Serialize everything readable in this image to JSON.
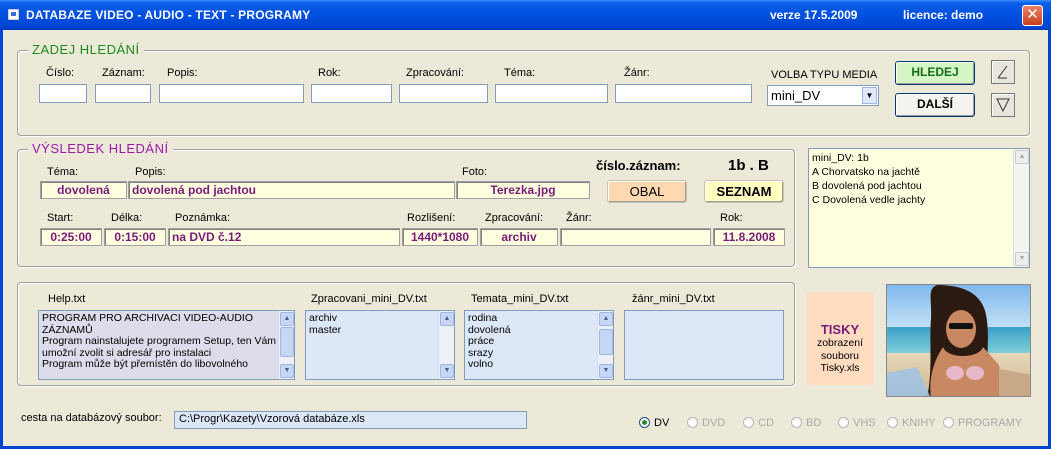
{
  "window": {
    "title": "DATABAZE  VIDEO - AUDIO - TEXT - PROGRAMY",
    "version": "verze 17.5.2009",
    "licence": "licence: demo",
    "close_glyph": "✕"
  },
  "search": {
    "legend": "ZADEJ  HLEDÁNÍ",
    "fields": [
      {
        "label": "Číslo:",
        "value": ""
      },
      {
        "label": "Záznam:",
        "value": ""
      },
      {
        "label": "Popis:",
        "value": ""
      },
      {
        "label": "Rok:",
        "value": ""
      },
      {
        "label": "Zpracování:",
        "value": ""
      },
      {
        "label": "Téma:",
        "value": ""
      },
      {
        "label": "Žánr:",
        "value": ""
      }
    ],
    "media_type_label": "VOLBA TYPU MEDIA",
    "media_type_value": "mini_DV",
    "search_button": "HLEDEJ",
    "next_button": "DALŠÍ"
  },
  "result": {
    "legend": "VÝSLEDEK  HLEDÁNÍ",
    "record_number_label": "číslo.záznam:",
    "record_number_value": "1b . B",
    "labels": {
      "tema": "Téma:",
      "popis": "Popis:",
      "foto": "Foto:",
      "start": "Start:",
      "delka": "Délka:",
      "poznamka": "Poznámka:",
      "rozliseni": "Rozlišení:",
      "zpracovani": "Zpracování:",
      "zanr": "Žánr:",
      "rok": "Rok:"
    },
    "values": {
      "tema": "dovolená",
      "popis": "dovolená pod jachtou",
      "foto": "Terezka.jpg",
      "start": "0:25:00",
      "delka": "0:15:00",
      "poznamka": "na DVD č.12",
      "rozliseni": "1440*1080",
      "zpracovani": "archiv",
      "zanr": "",
      "rok": "11.8.2008"
    },
    "cover_button": "OBAL",
    "list_button": "SEZNAM",
    "record_list": [
      "mini_DV: 1b",
      "A Chorvatsko na jachtě",
      "B dovolená pod jachtou",
      "C Dovolená vedle jachty"
    ]
  },
  "lists": {
    "help": {
      "title": "Help.txt",
      "lines": [
        "PROGRAM PRO ARCHIVACI VIDEO-AUDIO",
        "ZÁZNAMŮ",
        "Program nainstalujete programem Setup, ten Vám",
        "umožní zvolit si adresář pro instalaci",
        "Program může být přemístěn do libovolného"
      ]
    },
    "zpracovani": {
      "title": "Zpracovani_mini_DV.txt",
      "lines": [
        "archiv",
        "master"
      ]
    },
    "temata": {
      "title": "Temata_mini_DV.txt",
      "lines": [
        "rodina",
        "dovolená",
        "práce",
        "srazy",
        "volno"
      ]
    },
    "zanr": {
      "title": "žánr_mini_DV.txt",
      "lines": []
    }
  },
  "tisky": {
    "title": "TISKY",
    "sub1": "zobrazení",
    "sub2": "souboru",
    "sub3": "Tisky.xls"
  },
  "path": {
    "label": "cesta na databázový soubor:",
    "value": "C:\\Progr\\Kazety\\Vzorová databáze.xls"
  },
  "media_radios": [
    {
      "label": "DV",
      "checked": true
    },
    {
      "label": "DVD",
      "checked": false
    },
    {
      "label": "CD",
      "checked": false
    },
    {
      "label": "BD",
      "checked": false
    },
    {
      "label": "VHS",
      "checked": false
    },
    {
      "label": "KNIHY",
      "checked": false
    },
    {
      "label": "PROGRAMY",
      "checked": false
    }
  ],
  "colors": {
    "titlebar": "#0050e0",
    "search_legend": "#1a8a1a",
    "result_legend": "#9a1aa8",
    "readonly_bg": "#ffffe0",
    "readonly_text": "#7a1a7a",
    "hledej_bg": "#d4f5c4",
    "obal_bg": "#ffd8b0",
    "seznam_bg": "#ffffc0",
    "list_bg": "#dce7f7",
    "tisky_bg": "#ffdcc0"
  }
}
